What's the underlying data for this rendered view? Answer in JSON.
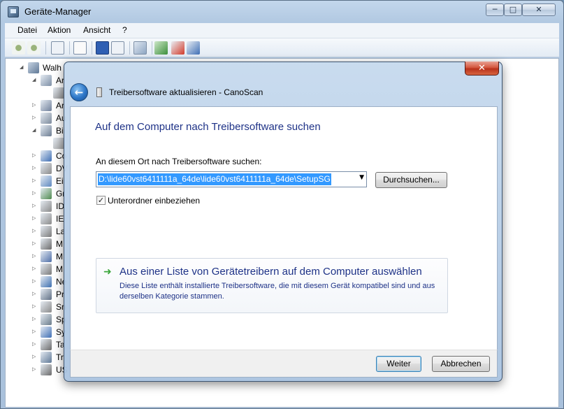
{
  "main_window": {
    "title": "Geräte-Manager",
    "controls": {
      "minimize": "─",
      "maximize": "□",
      "close": "✕"
    }
  },
  "menubar": {
    "items": [
      "Datei",
      "Aktion",
      "Ansicht",
      "?"
    ]
  },
  "tree": {
    "root_label": "Walh",
    "rows": [
      "Ar",
      "",
      "Ar",
      "Au",
      "Bi",
      "",
      "Co",
      "DV",
      "Ei",
      "Gr",
      "ID",
      "IE",
      "La",
      "M",
      "M",
      "M",
      "Ne",
      "Pr",
      "Sn",
      "Sp",
      "Sy",
      "Ta",
      "Tr",
      "US"
    ]
  },
  "dialog": {
    "title": "Treibersoftware aktualisieren - CanoScan",
    "heading": "Auf dem Computer nach Treibersoftware suchen",
    "location_label": "An diesem Ort nach Treibersoftware suchen:",
    "path_value": "D:\\lide60vst6411111a_64de\\lide60vst6411111a_64de\\SetupSG",
    "browse_label": "Durchsuchen...",
    "subfolder_label": "Unterordner einbeziehen",
    "subfolder_checked": true,
    "pick_title": "Aus einer Liste von Gerätetreibern auf dem Computer auswählen",
    "pick_description": "Diese Liste enthält installierte Treibersoftware, die mit diesem Gerät kompatibel sind und aus derselben Kategorie stammen.",
    "next_label": "Weiter",
    "cancel_label": "Abbrechen",
    "close_glyph": "✕",
    "check_glyph": "✓",
    "back_glyph": "←",
    "arrow_glyph": "➜"
  },
  "colors": {
    "link_blue": "#1e3287",
    "selection": "#3399ff",
    "close_red": "#c8432a"
  }
}
